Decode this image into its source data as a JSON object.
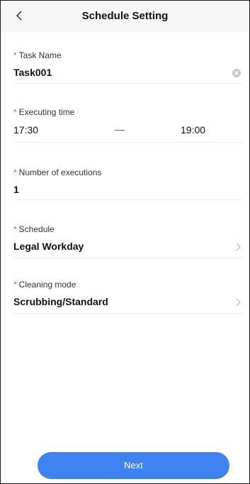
{
  "header": {
    "title": "Schedule Setting"
  },
  "task_name": {
    "required_mark": "*",
    "label": "Task Name",
    "value": "Task001"
  },
  "executing_time": {
    "required_mark": "*",
    "label": "Executing time",
    "start": "17:30",
    "separator": "—",
    "end": "19:00"
  },
  "executions": {
    "required_mark": "*",
    "label": "Number of executions",
    "value": "1"
  },
  "schedule": {
    "required_mark": "*",
    "label": "Schedule",
    "value": "Legal Workday"
  },
  "cleaning_mode": {
    "required_mark": "*",
    "label": "Cleaning mode",
    "value": "Scrubbing/Standard"
  },
  "footer": {
    "next_label": "Next"
  },
  "colors": {
    "accent": "#3e82f2",
    "required": "#e84d4d"
  }
}
